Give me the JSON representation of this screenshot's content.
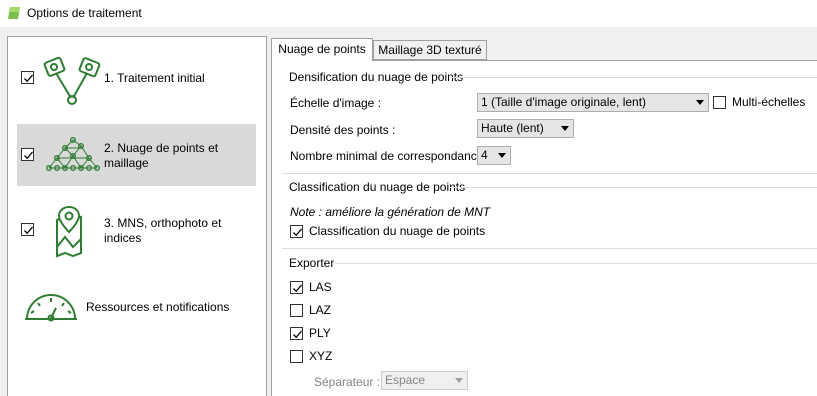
{
  "window": {
    "title": "Options de traitement",
    "accent": "#2e7d32"
  },
  "steps": [
    {
      "label": "1. Traitement initial",
      "checked": true,
      "icon": "camera-tie-points-icon"
    },
    {
      "label": "2. Nuage de points et maillage",
      "checked": true,
      "icon": "point-cloud-mesh-icon"
    },
    {
      "label": "3. MNS, orthophoto et indices",
      "checked": true,
      "icon": "map-pin-icon"
    },
    {
      "label": "Ressources et notifications",
      "icon": "gauge-icon"
    }
  ],
  "tabs": [
    {
      "label": "Nuage de points",
      "active": true
    },
    {
      "label": "Maillage 3D texturé",
      "active": false
    }
  ],
  "densification": {
    "title": "Densification du nuage de points",
    "image_scale_label": "Échelle d'image :",
    "image_scale_value": "1 (Taille d'image originale, lent)",
    "multiscale_label": "Multi-échelles",
    "multiscale_checked": false,
    "density_label": "Densité des points :",
    "density_value": "Haute (lent)",
    "min_matches_label": "Nombre minimal de correspondances :",
    "min_matches_value": "4"
  },
  "classification": {
    "title": "Classification du nuage de points",
    "note": "Note : améliore la génération de MNT",
    "checkbox_label": "Classification du nuage de points",
    "checked": true
  },
  "export": {
    "title": "Exporter",
    "formats": [
      {
        "label": "LAS",
        "checked": true
      },
      {
        "label": "LAZ",
        "checked": false
      },
      {
        "label": "PLY",
        "checked": true
      },
      {
        "label": "XYZ",
        "checked": false
      }
    ],
    "separator_label": "Séparateur :",
    "separator_value": "Espace"
  }
}
